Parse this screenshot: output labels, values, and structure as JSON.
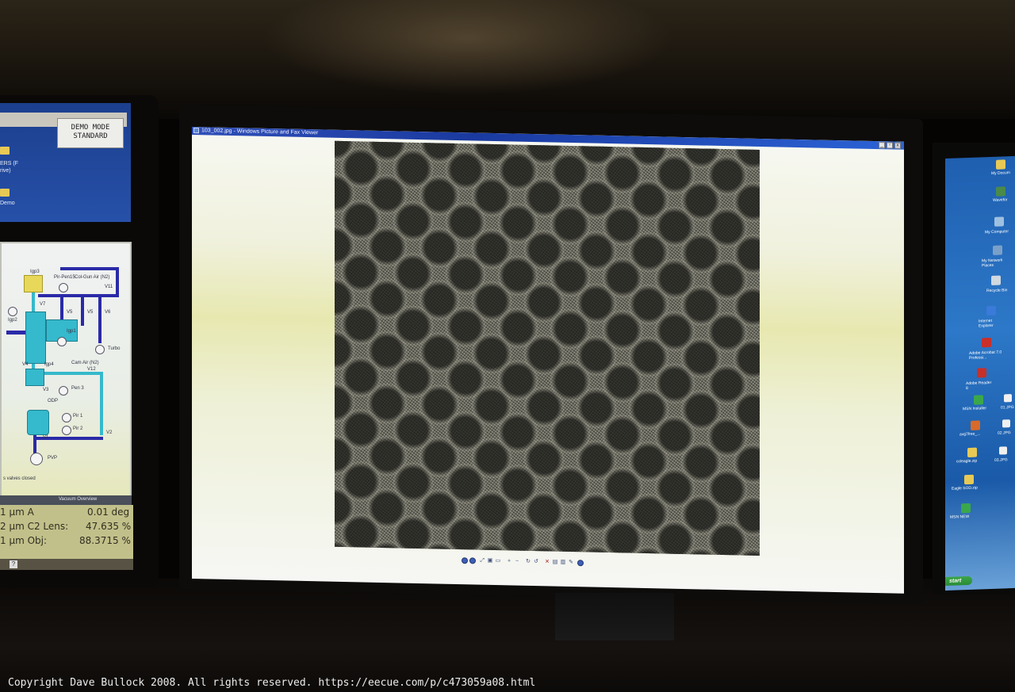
{
  "left_monitor": {
    "demo_badge": [
      "DEMO MODE",
      "STANDARD"
    ],
    "desktop_labels": [
      "ERS (F",
      "rive)",
      "Demo"
    ],
    "vacuum_labels": {
      "igp3": "Igp3",
      "pir_pen": "Pir-Pen",
      "pir_pen_num": "15",
      "col_gun_air": "Col-Gun Air (N2)",
      "v11": "V11",
      "v7": "V7",
      "igp2": "Igp2",
      "igp1": "Igp1",
      "v5a": "V5",
      "v5b": "V5",
      "v6": "V6",
      "turbo": "Turbo",
      "v4": "V4",
      "igp4": "Igp4",
      "cam_air": "Cam Air (N2)",
      "v12": "V12",
      "v3": "V3",
      "pen3": "Pen 3",
      "odp": "ODP",
      "pir1": "Pir 1",
      "pir2": "Pir 2",
      "v1": "V1",
      "v2": "V2",
      "pvp": "PVP",
      "status": "s valves closed"
    },
    "tab_title": "Vacuum Overview",
    "readout": [
      {
        "left": "1 μm A",
        "right": "0.01 deg"
      },
      {
        "left": "2 μm C2 Lens:",
        "right": "47.635 %"
      },
      {
        "left": "1 μm Obj:",
        "right": "88.3715 %"
      }
    ],
    "help_button": "?"
  },
  "center_monitor": {
    "window_title": "103_002.jpg - Windows Picture and Fax Viewer",
    "window_buttons": [
      "_",
      "▫",
      "x"
    ],
    "image_content": "cryo-electron micrograph of circular particles",
    "toolbar_icons": [
      "previous-icon",
      "next-icon",
      "best-fit-icon",
      "actual-size-icon",
      "slideshow-icon",
      "zoom-in-icon",
      "zoom-out-icon",
      "rotate-cw-icon",
      "rotate-ccw-icon",
      "delete-icon",
      "print-icon",
      "copy-to-icon",
      "edit-icon",
      "help-icon"
    ]
  },
  "right_monitor": {
    "desktop_icons": [
      {
        "label": "My Docum",
        "color": "#e8c955"
      },
      {
        "label": "Wavefor",
        "color": "#4a8a4a"
      },
      {
        "label": "My Computer",
        "color": "#9ec0e0"
      },
      {
        "label": "My Network Places",
        "color": "#7aa0c8"
      },
      {
        "label": "Recycle Bin",
        "color": "#d0d8e0"
      },
      {
        "label": "Internet Explorer",
        "color": "#3a7ad8"
      },
      {
        "label": "Adobe Acrobat 7.0 Professi...",
        "color": "#c8302a"
      },
      {
        "label": "Adobe Reader 8",
        "color": "#c8302a"
      },
      {
        "label": "MSN Installer",
        "color": "#3aa84a"
      },
      {
        "label": "avg7free_...",
        "color": "#d86a2a"
      },
      {
        "label": "ccleagle.zip",
        "color": "#e8c955"
      },
      {
        "label": "Eagle SOD.zip",
        "color": "#e8c955"
      },
      {
        "label": "MSN NEW",
        "color": "#3aa84a"
      }
    ],
    "file_icons": [
      "01.JPG",
      "02.JPG",
      "03.JPG"
    ],
    "start_label": "start"
  },
  "footer": {
    "copyright": "Copyright Dave Bullock 2008. All rights reserved. https://eecue.com/p/c473059a08.html"
  }
}
